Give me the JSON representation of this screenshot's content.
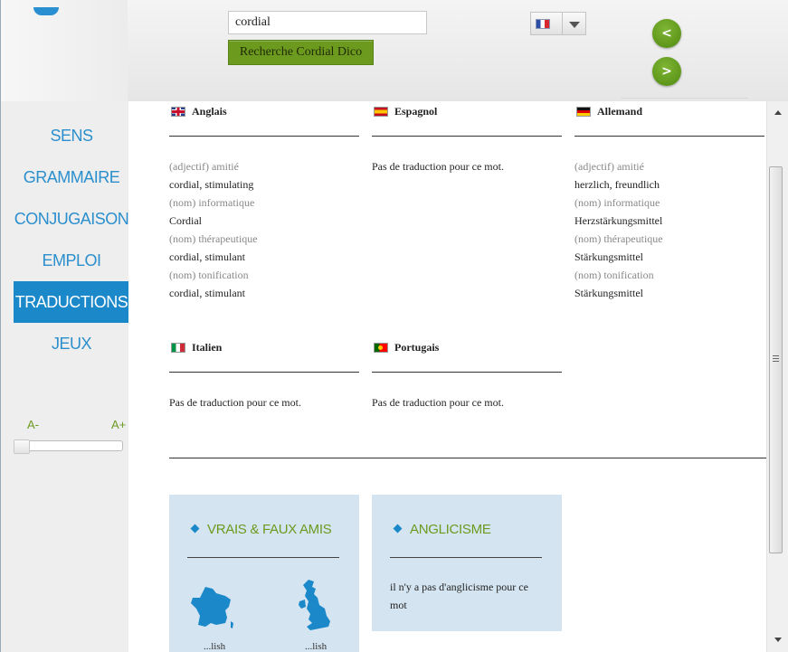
{
  "header": {
    "search": {
      "value": "cordial"
    },
    "search_button_label": "Recherche Cordial Dico",
    "language_flag": "flag-fr-icon",
    "prev_label": "<",
    "next_label": ">"
  },
  "sidebar": {
    "items": [
      {
        "label": "SENS",
        "active": false
      },
      {
        "label": "GRAMMAIRE",
        "active": false
      },
      {
        "label": "CONJUGAISON",
        "active": false
      },
      {
        "label": "EMPLOI",
        "active": false
      },
      {
        "label": "TRADUCTIONS",
        "active": true
      },
      {
        "label": "JEUX",
        "active": false
      }
    ],
    "font_decrease": "A-",
    "font_increase": "A+",
    "font_size_level": 0
  },
  "translations": [
    {
      "language": "Anglais",
      "entries": [
        {
          "label": "(adjectif) amitié",
          "value": "cordial, stimulating"
        },
        {
          "label": "(nom) informatique",
          "value": "Cordial"
        },
        {
          "label": "(nom) thérapeutique",
          "value": "cordial, stimulant"
        },
        {
          "label": "(nom) tonification",
          "value": "cordial, stimulant"
        }
      ]
    },
    {
      "language": "Espagnol",
      "none": "Pas de traduction pour ce mot."
    },
    {
      "language": "Allemand",
      "entries": [
        {
          "label": "(adjectif) amitié",
          "value": "herzlich, freundlich"
        },
        {
          "label": "(nom) informatique",
          "value": "Herzstärkungsmittel"
        },
        {
          "label": "(nom) thérapeutique",
          "value": "Stärkungsmittel"
        },
        {
          "label": "(nom) tonification",
          "value": "Stärkungsmittel"
        }
      ]
    },
    {
      "language": "Italien",
      "none": "Pas de traduction pour ce mot."
    },
    {
      "language": "Portugais",
      "none": "Pas de traduction pour ce mot."
    }
  ],
  "cards": {
    "vrais_faux_amis": {
      "title": "VRAIS & FAUX AMIS",
      "caption_left": "...lish",
      "caption_right": "...lish"
    },
    "anglicisme": {
      "title": "ANGLICISME",
      "text": "il n'y a pas d'anglicisme pour ce mot"
    }
  },
  "colors": {
    "accent_blue": "#1a88c9",
    "accent_green": "#6c9a1f",
    "card_bg": "#d4e4f0"
  }
}
